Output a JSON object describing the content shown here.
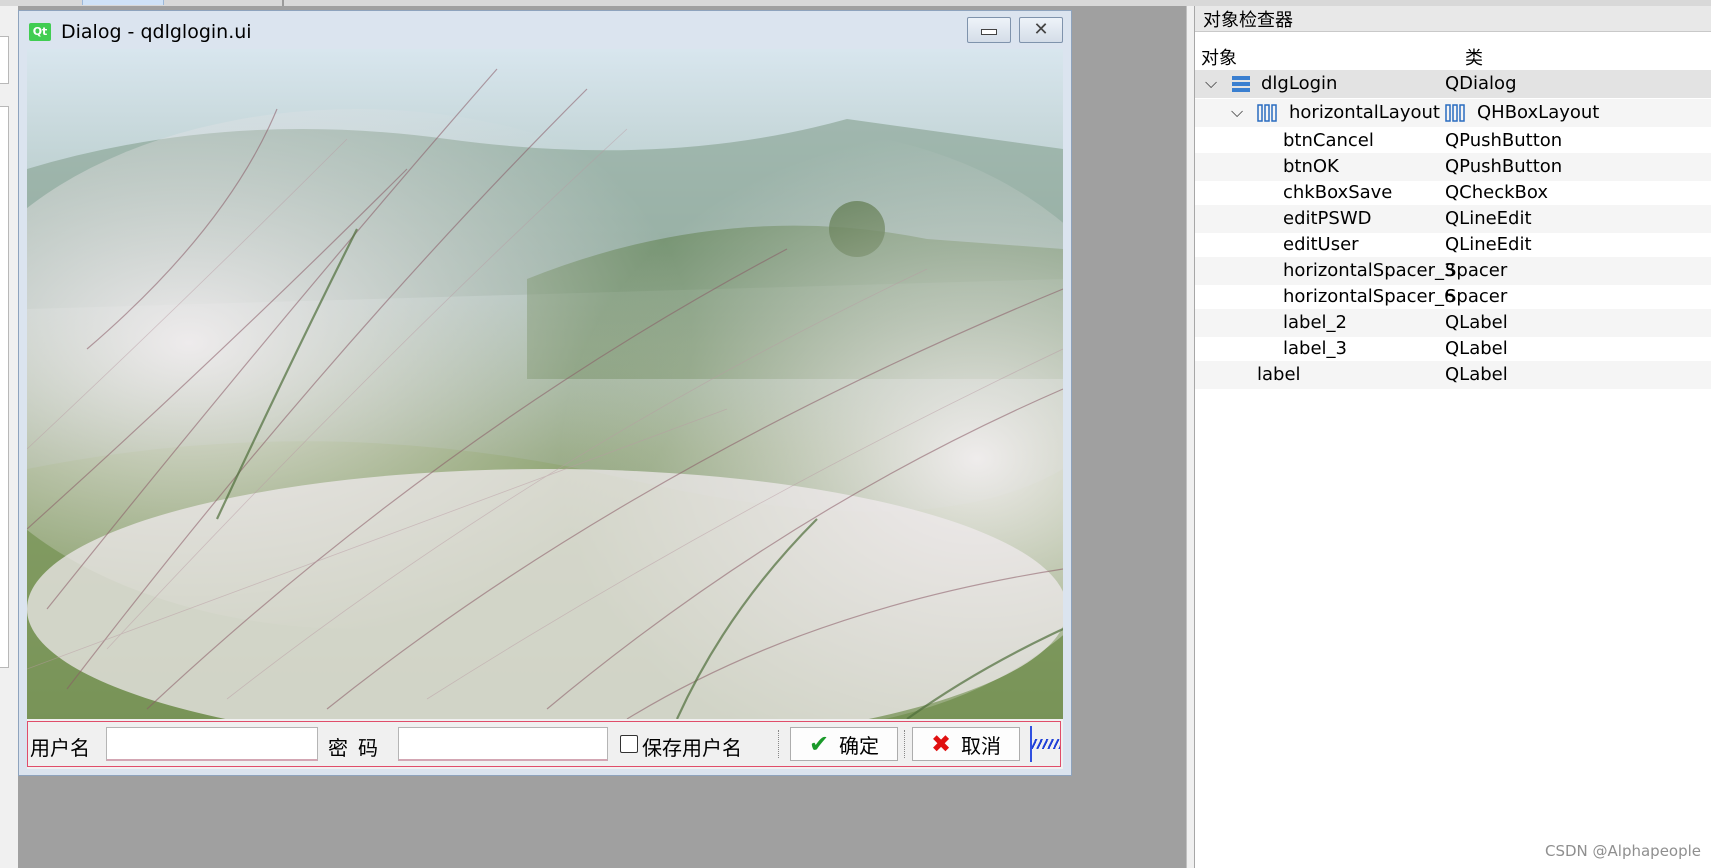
{
  "dialog": {
    "title": "Dialog - qdlglogin.ui",
    "logo": "Qt",
    "min_glyph": "—",
    "close_glyph": "✕"
  },
  "form": {
    "user_label": "用户名",
    "pwd_label": "密码",
    "user_value": "",
    "pwd_value": "",
    "save_checkbox_label": "保存用户名",
    "save_checked": false,
    "ok_label": "确定",
    "cancel_label": "取消",
    "ok_icon": "checkmark-icon",
    "cancel_icon": "red-x-icon"
  },
  "inspector": {
    "title": "对象检查器",
    "col_object": "对象",
    "col_class": "类",
    "rows": [
      {
        "name": "dlgLogin",
        "class": "QDialog",
        "level": 0,
        "expanded": true,
        "icon": "dialog-icon",
        "selected": true
      },
      {
        "name": "horizontalLayout",
        "class": "QHBoxLayout",
        "level": 1,
        "expanded": true,
        "icon": "hbox-layout-icon"
      },
      {
        "name": "btnCancel",
        "class": "QPushButton",
        "level": 2
      },
      {
        "name": "btnOK",
        "class": "QPushButton",
        "level": 2
      },
      {
        "name": "chkBoxSave",
        "class": "QCheckBox",
        "level": 2
      },
      {
        "name": "editPSWD",
        "class": "QLineEdit",
        "level": 2
      },
      {
        "name": "editUser",
        "class": "QLineEdit",
        "level": 2
      },
      {
        "name": "horizontalSpacer_3",
        "class": "Spacer",
        "level": 2
      },
      {
        "name": "horizontalSpacer_6",
        "class": "Spacer",
        "level": 2
      },
      {
        "name": "label_2",
        "class": "QLabel",
        "level": 2
      },
      {
        "name": "label_3",
        "class": "QLabel",
        "level": 2
      },
      {
        "name": "label",
        "class": "QLabel",
        "level": 1
      }
    ]
  },
  "watermark": {
    "csdn": "CSDN @Alphapeople"
  },
  "colors": {
    "qt_green": "#41cd52",
    "layout_border": "#e04d6a",
    "spacer_blue": "#2040d8"
  }
}
